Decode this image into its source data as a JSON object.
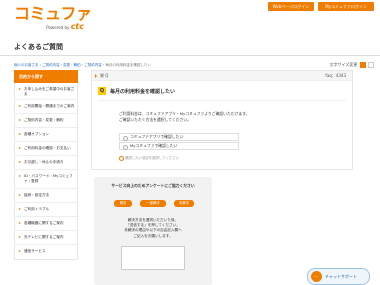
{
  "header": {
    "logo_text": "コミュファ",
    "logo_powered": "Powered by",
    "logo_brand": "ctc",
    "buttons": [
      "Webページログイン",
      "Myコミュファログイン"
    ]
  },
  "page": {
    "title": "よくあるご質問"
  },
  "breadcrumb": {
    "items": [
      "個人のお客さま",
      "ご契約内容・変更・解約",
      "ご契約内容",
      "毎月の利用料金を確認したい"
    ]
  },
  "font_size": {
    "label": "文字サイズ変更",
    "options": [
      "中",
      "大"
    ]
  },
  "sidebar": {
    "heading": "目的から探す",
    "items": [
      "お申し込みをご希望中のお客さま",
      "ご利用開始・開通までのご案内",
      "ご契約内容・変更・解約",
      "各種オプション",
      "ご利用料金の確認・お支払い",
      "お引越し・休止の手続き",
      "ID・パスワード・Myコミュファ・登録",
      "接続・設定方法",
      "ご利用トラブル",
      "各種機器に関するご案内",
      "光テレビに関するご案内",
      "通信サービス"
    ]
  },
  "qa": {
    "bar_label": "質 Q",
    "id_label": "faq：4343",
    "badge": "Q",
    "question": "毎月の利用料金を確認したい",
    "body_lines": [
      "ご利用料金は、コミュファアプリ・Myコミュファよりご確認いただけます。",
      "ご確認いただく方法を選択してください。"
    ],
    "options": [
      "コミュファアプリで確認したい",
      "Myコミュファで確認したい"
    ],
    "hint": "確認したい項目を選択してください"
  },
  "survey": {
    "title": "サービス向上のためアンケートにご協力ください",
    "choices": [
      "解決",
      "一部解決",
      "未解決"
    ],
    "note_lines": [
      "解決方法を選択いただいた後、",
      "「送信する」を押してください。",
      "未解決の理由や以下の自由記入欄へ",
      "ご記入をお願いします。"
    ]
  },
  "chat": {
    "label": "チャットサポート",
    "icon": "chat-bubble-icon"
  },
  "colors": {
    "brand_orange": "#ef7d00",
    "badge_yellow": "#ffcc00",
    "link_blue": "#2a6ebb"
  }
}
